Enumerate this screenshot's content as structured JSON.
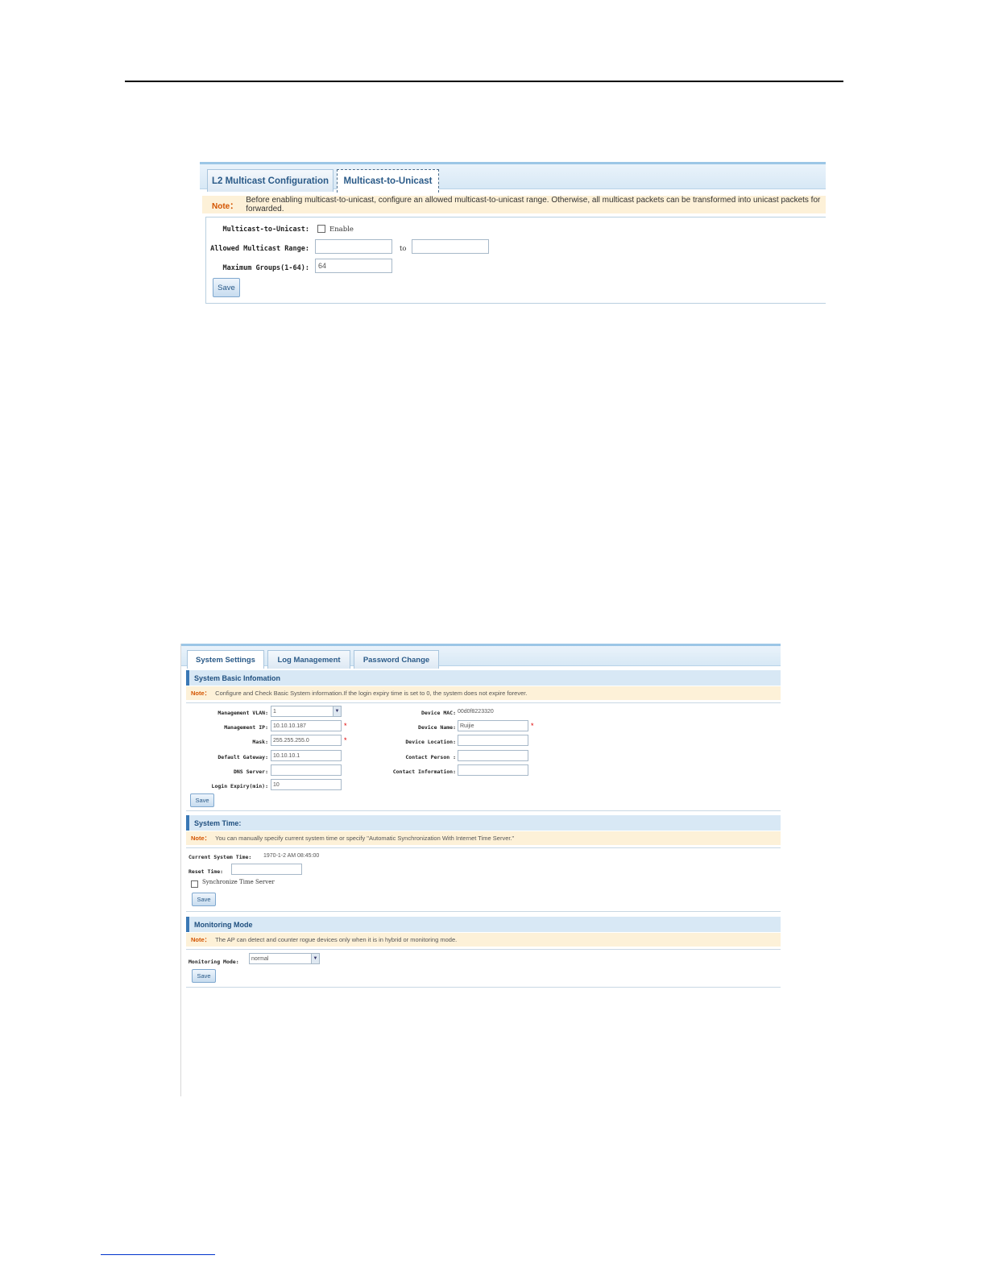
{
  "shot1": {
    "tabs": [
      "L2 Multicast Configuration",
      "Multicast-to-Unicast"
    ],
    "note_label": "Note：",
    "note_text": "Before enabling multicast-to-unicast, configure an allowed multicast-to-unicast range. Otherwise, all multicast packets can be transformed into unicast packets for forwarded.",
    "fields": {
      "m2u_label": "Multicast-to-Unicast:",
      "enable_label": "Enable",
      "range_label": "Allowed Multicast Range:",
      "to_label": "to",
      "range_from": "",
      "range_to": "",
      "max_groups_label": "Maximum Groups(1-64):",
      "max_groups_value": "64"
    },
    "save_label": "Save"
  },
  "shot2": {
    "tabs": [
      "System Settings",
      "Log Management",
      "Password Change"
    ],
    "basic": {
      "header": "System Basic Infomation",
      "note_label": "Note：",
      "note_text": "Configure and Check Basic System information.If the login expiry time is set to 0, the system does not expire forever.",
      "mgmt_vlan_label": "Management VLAN:",
      "mgmt_vlan_value": "1",
      "mgmt_ip_label": "Management IP:",
      "mgmt_ip_value": "10.10.10.187",
      "mask_label": "Mask:",
      "mask_value": "255.255.255.0",
      "gateway_label": "Default Gateway:",
      "gateway_value": "10.10.10.1",
      "dns_label": "DNS Server:",
      "dns_value": "",
      "expiry_label": "Login Expiry(min):",
      "expiry_value": "10",
      "mac_label": "Device MAC:",
      "mac_value": "00d0f8223320",
      "name_label": "Device Name:",
      "name_value": "Ruijie",
      "location_label": "Device Location:",
      "contact_person_label": "Contact Person :",
      "contact_info_label": "Contact Information:",
      "save_label": "Save"
    },
    "time": {
      "header": "System Time:",
      "note_label": "Note：",
      "note_text": "You can manually specify current system time or specify \"Automatic Synchronization With Internet Time Server.\"",
      "current_label": "Current System Time:",
      "current_value": "1970-1-2 AM 08:45:00",
      "reset_label": "Reset Time:",
      "sync_label": "Synchronize Time Server",
      "save_label": "Save"
    },
    "monitor": {
      "header": "Monitoring Mode",
      "note_label": "Note：",
      "note_text": "The AP can detect and counter rogue devices only when it is in hybrid or monitoring mode.",
      "mode_label": "Monitoring Mode:",
      "mode_value": "normal",
      "save_label": "Save"
    }
  }
}
